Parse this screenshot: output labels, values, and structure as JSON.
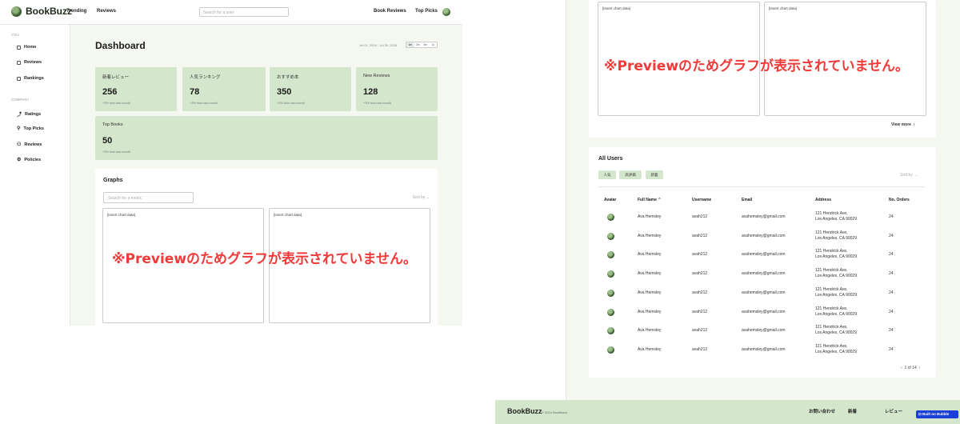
{
  "app": {
    "brand": "BookBuzz",
    "nav": [
      "Trending",
      "Reviews"
    ],
    "search_placeholder": "Search for a user",
    "right_links": [
      "Book Reviews",
      "Top Picks"
    ]
  },
  "sidebar": {
    "groups": [
      {
        "label": "YOU",
        "items": [
          {
            "label": "Home",
            "icon": "grid-icon"
          },
          {
            "label": "Reviews",
            "icon": "document-icon"
          },
          {
            "label": "Rankings",
            "icon": "list-icon"
          }
        ]
      },
      {
        "label": "COMPANY",
        "items": [
          {
            "label": "Ratings",
            "icon": "trend-icon"
          },
          {
            "label": "Top Picks",
            "icon": "pin-icon"
          },
          {
            "label": "Reviews",
            "icon": "users-icon"
          },
          {
            "label": "Policies",
            "icon": "gear-icon"
          }
        ]
      }
    ]
  },
  "dashboard": {
    "title": "Dashboard",
    "date_range": "Jul 01, 2024 - Jul 30, 2024",
    "ranges": [
      "1m",
      "3m",
      "6m",
      "1y"
    ],
    "active_range": 0,
    "stats": [
      {
        "label": "新着レビュー",
        "value": "256",
        "sub": "+3% from last month"
      },
      {
        "label": "人気ランキング",
        "value": "78",
        "sub": "+3% from last month"
      },
      {
        "label": "おすすめ本",
        "value": "350",
        "sub": "+3% from last month"
      },
      {
        "label": "New Reviews",
        "value": "128",
        "sub": "+3% from last month"
      },
      {
        "label": "Top Books",
        "value": "50",
        "sub": "+3% from last month"
      }
    ],
    "graphs_title": "Graphs",
    "metric_placeholder": "Search for a metric",
    "sort_label": "Sort by",
    "chart_placeholder": "[Insert chart data]",
    "preview_notice": "※Previewのためグラフが表示されていません。"
  },
  "right_panel": {
    "chart_placeholder": "[Insert chart data]",
    "preview_notice": "※Previewのためグラフが表示されていません。",
    "view_more": "View more",
    "users_title": "All Users",
    "chips": [
      "人気",
      "高評価",
      "新着"
    ],
    "sort_label": "Sort by",
    "columns": [
      "Avatar",
      "Full Name",
      "Username",
      "Email",
      "Address",
      "No. Orders"
    ],
    "rows": [
      {
        "name": "Ava Hemsley",
        "username": "avah212",
        "email": "avahemsley@gmail.com",
        "address1": "121 Hendrick Ave,",
        "address2": "Los Angeles, CA 90029",
        "orders": "24"
      },
      {
        "name": "Ava Hemsley",
        "username": "avah212",
        "email": "avahemsley@gmail.com",
        "address1": "121 Hendrick Ave,",
        "address2": "Los Angeles, CA 90029",
        "orders": "24"
      },
      {
        "name": "Ava Hemsley",
        "username": "avah212",
        "email": "avahemsley@gmail.com",
        "address1": "121 Hendrick Ave,",
        "address2": "Los Angeles, CA 90029",
        "orders": "24"
      },
      {
        "name": "Ava Hemsley",
        "username": "avah212",
        "email": "avahemsley@gmail.com",
        "address1": "121 Hendrick Ave,",
        "address2": "Los Angeles, CA 90029",
        "orders": "24"
      },
      {
        "name": "Ava Hemsley",
        "username": "avah212",
        "email": "avahemsley@gmail.com",
        "address1": "121 Hendrick Ave,",
        "address2": "Los Angeles, CA 90029",
        "orders": "24"
      },
      {
        "name": "Ava Hemsley",
        "username": "avah212",
        "email": "avahemsley@gmail.com",
        "address1": "121 Hendrick Ave,",
        "address2": "Los Angeles, CA 90029",
        "orders": "24"
      },
      {
        "name": "Ava Hemsley",
        "username": "avah212",
        "email": "avahemsley@gmail.com",
        "address1": "121 Hendrick Ave,",
        "address2": "Los Angeles, CA 90029",
        "orders": "24"
      },
      {
        "name": "Ava Hemsley",
        "username": "avah212",
        "email": "avahemsley@gmail.com",
        "address1": "121 Hendrick Ave,",
        "address2": "Los Angeles, CA 90029",
        "orders": "24"
      }
    ],
    "pagination": "1 of 14"
  },
  "footer": {
    "brand": "BookBuzz",
    "copyright": "© 2024 BookBuzz",
    "links": [
      "お問い合わせ",
      "新着",
      "レビュー"
    ],
    "bubble_label": "Built on Bubble"
  },
  "colors": {
    "accent": "#d4e6cc",
    "page_bg": "#f4f8f0",
    "notice": "#f03a3a",
    "bubble": "#1a3fd6"
  }
}
